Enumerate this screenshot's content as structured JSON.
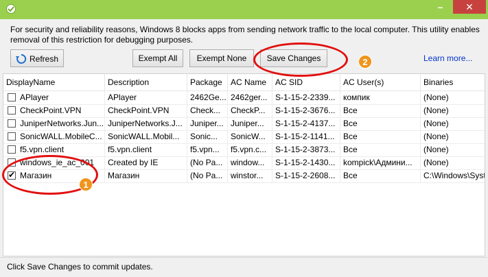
{
  "window": {
    "icon": "checkmark-shield-icon",
    "minimize_glyph": "–",
    "close_glyph": "✕",
    "accent": "#9bd04f",
    "close_color": "#c7423f"
  },
  "info_text": "For security and reliability reasons, Windows 8 blocks apps from sending network traffic to the local computer. This utility enables removal of this restriction for debugging purposes.",
  "toolbar": {
    "refresh_label": "Refresh",
    "refresh_icon": "refresh-icon",
    "exempt_all_label": "Exempt All",
    "exempt_none_label": "Exempt None",
    "save_changes_label": "Save Changes",
    "learn_more_label": "Learn more..."
  },
  "table": {
    "columns": [
      "DisplayName",
      "Description",
      "Package",
      "AC Name",
      "AC SID",
      "AC User(s)",
      "Binaries"
    ],
    "rows": [
      {
        "checked": false,
        "cells": [
          "APlayer",
          "APlayer",
          "2462Ge...",
          "2462ger...",
          "S-1-15-2-2339...",
          "компик",
          "(None)"
        ]
      },
      {
        "checked": false,
        "cells": [
          "CheckPoint.VPN",
          "CheckPoint.VPN",
          "Check...",
          "CheckP...",
          "S-1-15-2-3676...",
          "Все",
          "(None)"
        ]
      },
      {
        "checked": false,
        "cells": [
          "JuniperNetworks.Jun...",
          "JuniperNetworks.J...",
          "Juniper...",
          "Juniper...",
          "S-1-15-2-4137...",
          "Все",
          "(None)"
        ]
      },
      {
        "checked": false,
        "cells": [
          "SonicWALL.MobileC...",
          "SonicWALL.Mobil...",
          "Sonic...",
          "SonicW...",
          "S-1-15-2-1141...",
          "Все",
          "(None)"
        ]
      },
      {
        "checked": false,
        "cells": [
          "f5.vpn.client",
          "f5.vpn.client",
          "f5.vpn...",
          "f5.vpn.c...",
          "S-1-15-2-3873...",
          "Все",
          "(None)"
        ]
      },
      {
        "checked": false,
        "cells": [
          "windows_ie_ac_001",
          "Created by IE",
          "(No Pa...",
          "window...",
          "S-1-15-2-1430...",
          "kompick\\Админи...",
          "(None)"
        ]
      },
      {
        "checked": true,
        "cells": [
          "Магазин",
          "Магазин",
          "(No Pa...",
          "winstor...",
          "S-1-15-2-2608...",
          "Все",
          "C:\\Windows\\Syst"
        ]
      }
    ]
  },
  "status_text": "Click Save Changes to commit updates.",
  "annotations": {
    "badge_1": "1",
    "badge_2": "2",
    "ellipse_color": "#e20f0f",
    "badge_color": "#f0941b"
  }
}
